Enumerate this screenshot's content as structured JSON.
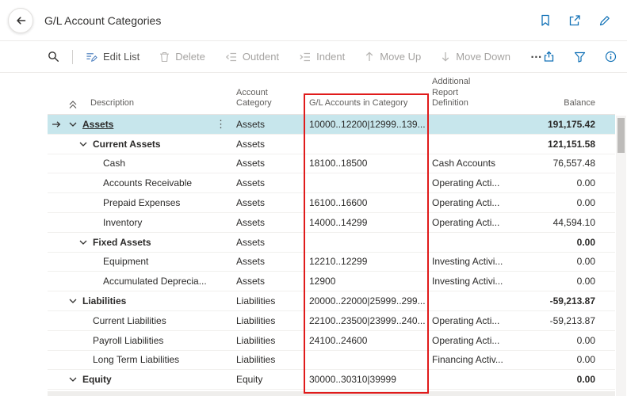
{
  "colors": {
    "accent": "#1171b6",
    "sel": "#c7e6ec",
    "red": "#e01b1b"
  },
  "header": {
    "title": "G/L Account Categories",
    "icons": [
      "bookmark-icon",
      "popout-icon",
      "edit-icon"
    ]
  },
  "toolbar": {
    "search_icon": "search-icon",
    "actions": [
      {
        "label": "Edit List",
        "icon": "edit-list-icon",
        "enabled": true
      },
      {
        "label": "Delete",
        "icon": "delete-icon",
        "enabled": false
      },
      {
        "label": "Outdent",
        "icon": "outdent-icon",
        "enabled": false
      },
      {
        "label": "Indent",
        "icon": "indent-icon",
        "enabled": false
      },
      {
        "label": "Move Up",
        "icon": "move-up-icon",
        "enabled": false
      },
      {
        "label": "Move Down",
        "icon": "move-down-icon",
        "enabled": false
      }
    ],
    "more_label": "…",
    "right_icons": [
      "share-icon",
      "filter-icon",
      "info-icon"
    ]
  },
  "table": {
    "columns": {
      "description": "Description",
      "account_category": "Account Category",
      "gl_accounts": "G/L Accounts in Category",
      "additional_report": "Additional Report Definition",
      "balance": "Balance"
    },
    "rows": [
      {
        "description": "Assets",
        "category": "Assets",
        "gl_accounts": "10000..12200|12999..139...",
        "report": "",
        "balance": "191,175.42",
        "level": 0,
        "bold": true,
        "chevron": true,
        "selected": true
      },
      {
        "description": "Current Assets",
        "category": "Assets",
        "gl_accounts": "",
        "report": "",
        "balance": "121,151.58",
        "level": 1,
        "bold": true,
        "chevron": true,
        "selected": false
      },
      {
        "description": "Cash",
        "category": "Assets",
        "gl_accounts": "18100..18500",
        "report": "Cash Accounts",
        "balance": "76,557.48",
        "level": 2,
        "bold": false,
        "chevron": false,
        "selected": false
      },
      {
        "description": "Accounts Receivable",
        "category": "Assets",
        "gl_accounts": "",
        "report": "Operating Acti...",
        "balance": "0.00",
        "level": 2,
        "bold": false,
        "chevron": false,
        "selected": false
      },
      {
        "description": "Prepaid Expenses",
        "category": "Assets",
        "gl_accounts": "16100..16600",
        "report": "Operating Acti...",
        "balance": "0.00",
        "level": 2,
        "bold": false,
        "chevron": false,
        "selected": false
      },
      {
        "description": "Inventory",
        "category": "Assets",
        "gl_accounts": "14000..14299",
        "report": "Operating Acti...",
        "balance": "44,594.10",
        "level": 2,
        "bold": false,
        "chevron": false,
        "selected": false
      },
      {
        "description": "Fixed Assets",
        "category": "Assets",
        "gl_accounts": "",
        "report": "",
        "balance": "0.00",
        "level": 1,
        "bold": true,
        "chevron": true,
        "selected": false
      },
      {
        "description": "Equipment",
        "category": "Assets",
        "gl_accounts": "12210..12299",
        "report": "Investing Activi...",
        "balance": "0.00",
        "level": 2,
        "bold": false,
        "chevron": false,
        "selected": false
      },
      {
        "description": "Accumulated Deprecia...",
        "category": "Assets",
        "gl_accounts": "12900",
        "report": "Investing Activi...",
        "balance": "0.00",
        "level": 2,
        "bold": false,
        "chevron": false,
        "selected": false
      },
      {
        "description": "Liabilities",
        "category": "Liabilities",
        "gl_accounts": "20000..22000|25999..299...",
        "report": "",
        "balance": "-59,213.87",
        "level": 0,
        "bold": true,
        "chevron": true,
        "selected": false
      },
      {
        "description": "Current Liabilities",
        "category": "Liabilities",
        "gl_accounts": "22100..23500|23999..240...",
        "report": "Operating Acti...",
        "balance": "-59,213.87",
        "level": 1,
        "bold": false,
        "chevron": false,
        "selected": false
      },
      {
        "description": "Payroll Liabilities",
        "category": "Liabilities",
        "gl_accounts": "24100..24600",
        "report": "Operating Acti...",
        "balance": "0.00",
        "level": 1,
        "bold": false,
        "chevron": false,
        "selected": false
      },
      {
        "description": "Long Term Liabilities",
        "category": "Liabilities",
        "gl_accounts": "",
        "report": "Financing Activ...",
        "balance": "0.00",
        "level": 1,
        "bold": false,
        "chevron": false,
        "selected": false
      },
      {
        "description": "Equity",
        "category": "Equity",
        "gl_accounts": "30000..30310|39999",
        "report": "",
        "balance": "0.00",
        "level": 0,
        "bold": true,
        "chevron": true,
        "selected": false
      }
    ]
  }
}
